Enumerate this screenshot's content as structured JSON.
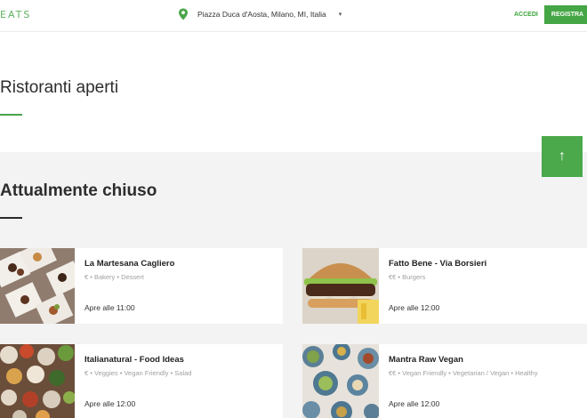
{
  "header": {
    "logo": "EATS",
    "address": "Piazza Duca d'Aosta, Milano, MI, Italia",
    "caret": "▾",
    "login": "ACCEDI",
    "register": "REGISTRA"
  },
  "open_section": {
    "title": "Ristoranti aperti"
  },
  "closed_section": {
    "title": "Attualmente chiuso"
  },
  "scroll_top_arrow": "↑",
  "restaurants": [
    {
      "name": "La Martesana Cagliero",
      "categories": "€ • Bakery • Dessert",
      "opens": "Apre alle 11:00"
    },
    {
      "name": "Fatto Bene - Via Borsieri",
      "categories": "€€ • Burgers",
      "opens": "Apre alle 12:00"
    },
    {
      "name": "Italianatural - Food Ideas",
      "categories": "€ • Veggies • Vegan Friendly • Salad",
      "opens": "Apre alle 12:00"
    },
    {
      "name": "Mantra Raw Vegan",
      "categories": "€€ • Vegan Friendly • Vegetarian / Vegan • Healthy",
      "opens": "Apre alle 12:00"
    }
  ]
}
